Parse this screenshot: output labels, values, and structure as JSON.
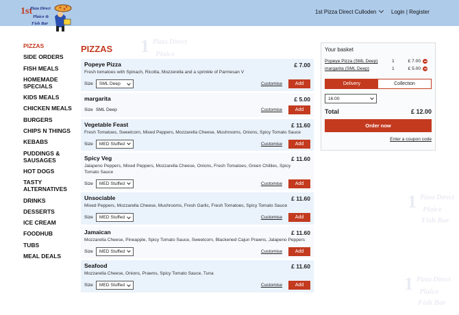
{
  "header": {
    "store_name": "1st Pizza Direct Culloden",
    "login": "Login",
    "separator": "|",
    "register": "Register"
  },
  "logo": {
    "line1": "1st",
    "line2": "Pizza Direct",
    "line3": "Plaice &",
    "line4": "Fish Bar"
  },
  "sidebar": {
    "items": [
      {
        "label": "PIZZAS",
        "active": true
      },
      {
        "label": "SIDE ORDERS"
      },
      {
        "label": "FISH MEALS"
      },
      {
        "label": "HOMEMADE SPECIALS"
      },
      {
        "label": "KIDS MEALS"
      },
      {
        "label": "CHICKEN MEALS"
      },
      {
        "label": "BURGERS"
      },
      {
        "label": "CHIPS N THINGS"
      },
      {
        "label": "KEBABS"
      },
      {
        "label": "PUDDINGS & SAUSAGES"
      },
      {
        "label": "HOT DOGS"
      },
      {
        "label": "TASTY ALTERNATIVES"
      },
      {
        "label": "DRINKS"
      },
      {
        "label": "DESSERTS"
      },
      {
        "label": "ICE CREAM"
      },
      {
        "label": "FOODHUB"
      },
      {
        "label": "TUBS"
      },
      {
        "label": "MEAL DEALS"
      }
    ]
  },
  "main": {
    "title": "PIZZAS",
    "size_label": "Size",
    "customise_label": "Customise",
    "add_label": "Add",
    "products": [
      {
        "name": "Popeye Pizza",
        "price": "£ 7.00",
        "desc": "Fresh tomatoes with Spinach, Ricotta, Mozzerella and a sprinkle of Parmesan V",
        "size": "SML Deep",
        "has_select": true
      },
      {
        "name": "margarita",
        "price": "£ 5.00",
        "desc": "",
        "size": "SML Deep",
        "has_select": false
      },
      {
        "name": "Vegetable Feast",
        "price": "£ 11.60",
        "desc": "Fresh Tomatoes, Sweetcorn, Mixed Peppers, Mozzarella Cheese, Mushrooms, Onions, Spicy Tomato Sauce",
        "size": "MED Stuffed",
        "has_select": true
      },
      {
        "name": "Spicy Veg",
        "price": "£ 11.60",
        "desc": "Jalapeno Peppers, Mixed Peppers, Mozzarella Cheese, Onions, Fresh Tomatoes, Green Chillies, Spicy Tomato Sauce",
        "size": "MED Stuffed",
        "has_select": true
      },
      {
        "name": "Unsociable",
        "price": "£ 11.60",
        "desc": "Mixed Peppers, Mozzarella Cheese, Mushrooms, Fresh Garlic, Fresh Tomatoes, Spicy Tomato Sauce",
        "size": "MED Stuffed",
        "has_select": true
      },
      {
        "name": "Jamaican",
        "price": "£ 11.60",
        "desc": "Mozzarella Cheese, Pineapple, Spicy Tomato Sauce, Sweetcorn, Blackened Cajun Prawns, Jalapeno Peppers",
        "size": "MED Stuffed",
        "has_select": true
      },
      {
        "name": "Seafood",
        "price": "£ 11.60",
        "desc": "Mozzarella Cheese, Onions, Prawns, Spicy Tomato Sauce, Tuna",
        "size": "MED Stuffed",
        "has_select": true
      }
    ]
  },
  "basket": {
    "title": "Your basket",
    "lines": [
      {
        "name": "Popeye Pizza (SML Deep)",
        "qty": "1",
        "price": "£ 7.00"
      },
      {
        "name": "margarita (SML Deep)",
        "qty": "1",
        "price": "£ 5.00"
      }
    ],
    "delivery_label": "Delivery",
    "collection_label": "Collection",
    "time": "16:00",
    "total_label": "Total",
    "total_value": "£ 12.00",
    "order_label": "Order now",
    "coupon_label": "Enter a coupon code"
  },
  "colors": {
    "accent": "#c33a1f",
    "header_bg": "#aecbea"
  }
}
